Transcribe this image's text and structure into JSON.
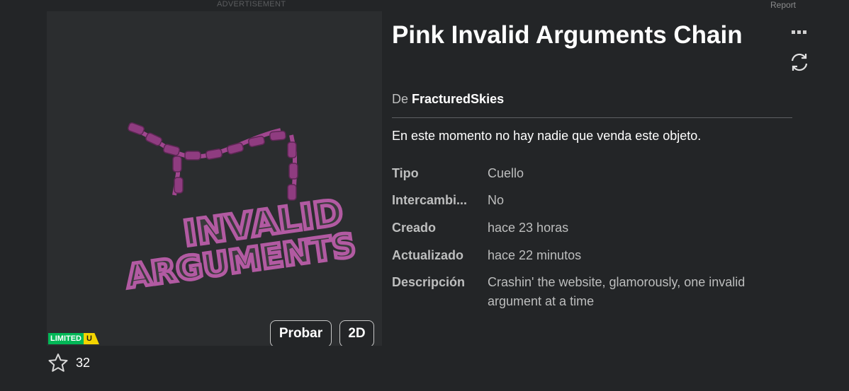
{
  "ad": {
    "label": "ADVERTISEMENT"
  },
  "report": {
    "label": "Report"
  },
  "item": {
    "title": "Pink Invalid Arguments Chain",
    "by_prefix": "De",
    "creator": "FracturedSkies",
    "no_sellers": "En este momento no hay nadie que venda este objeto.",
    "details": [
      {
        "key": "Tipo",
        "value": "Cuello"
      },
      {
        "key": "Intercambi...",
        "value": "No"
      },
      {
        "key": "Creado",
        "value": "hace 23 horas"
      },
      {
        "key": "Actualizado",
        "value": "hace 22 minutos"
      },
      {
        "key": "Descripción",
        "value": "Crashin' the website, glamorously, one invalid argument at a time"
      }
    ],
    "art_text_1": "INVALID",
    "art_text_2": "ARGUMENTS"
  },
  "thumbnail": {
    "try_label": "Probar",
    "view_2d_label": "2D"
  },
  "badge": {
    "limited": "LIMITED",
    "unique": "U"
  },
  "favorites": {
    "count": "32"
  },
  "icons": {
    "more": "more-options-icon",
    "refresh": "refresh-icon",
    "star": "star-icon"
  },
  "colors": {
    "background": "#232527",
    "limited_green": "#02b757",
    "unique_yellow": "#f4d400",
    "chain_pink": "#a0468f"
  }
}
